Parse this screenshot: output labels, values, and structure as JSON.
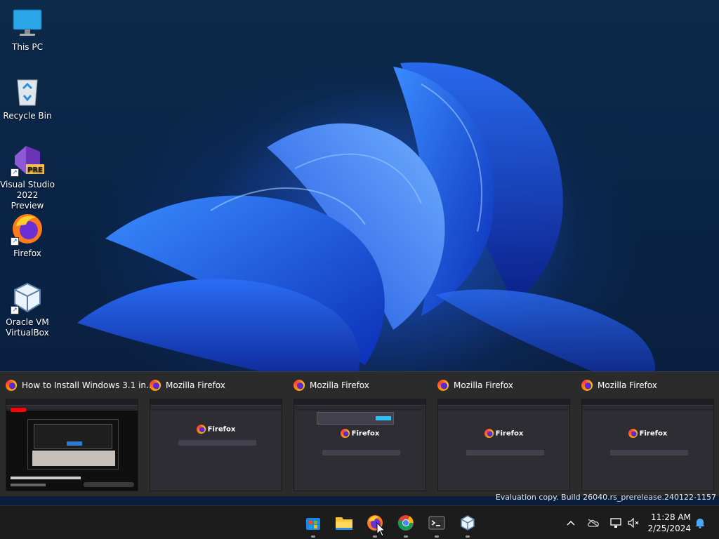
{
  "desktop": {
    "icons": [
      {
        "label_1": "This PC",
        "label_2": ""
      },
      {
        "label_1": "Recycle Bin",
        "label_2": ""
      },
      {
        "label_1": "Visual Studio",
        "label_2": "2022 Preview",
        "badge": "PRE"
      },
      {
        "label_1": "Firefox",
        "label_2": ""
      },
      {
        "label_1": "Oracle VM",
        "label_2": "VirtualBox"
      }
    ],
    "watermark": "Evaluation copy. Build 26040.rs_prerelease.240122-1157"
  },
  "thumbnails": [
    {
      "title": "How to Install Windows 3.1 in...",
      "kind": "youtube"
    },
    {
      "title": "Mozilla Firefox",
      "kind": "newtab",
      "logo_text": "Firefox"
    },
    {
      "title": "Mozilla Firefox",
      "kind": "newtab",
      "logo_text": "Firefox"
    },
    {
      "title": "Mozilla Firefox",
      "kind": "newtab",
      "logo_text": "Firefox"
    },
    {
      "title": "Mozilla Firefox",
      "kind": "newtab",
      "logo_text": "Firefox"
    }
  ],
  "taskbar": {
    "apps": [
      "start",
      "file-explorer",
      "firefox",
      "chrome",
      "terminal",
      "virtualbox"
    ],
    "tray": {
      "time": "11:28 AM",
      "date": "2/25/2024"
    }
  },
  "colors": {
    "taskbar_bg": "#1c1c1c",
    "strip_bg": "#2b2b2b",
    "accent": "#1a6ff5"
  }
}
